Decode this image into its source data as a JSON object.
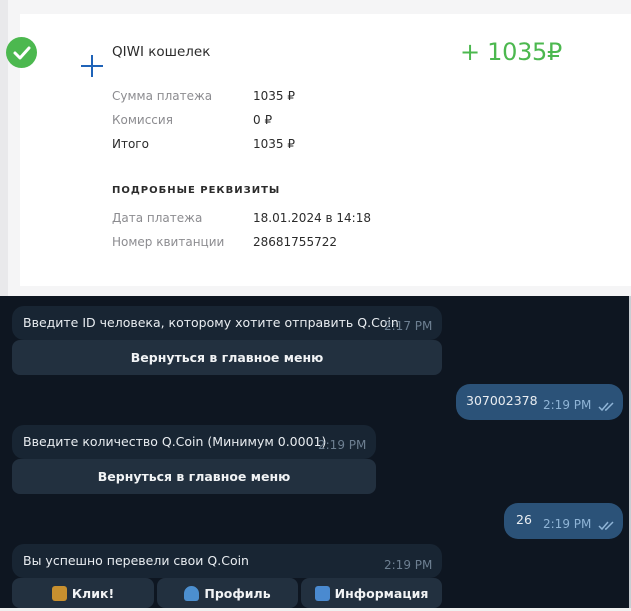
{
  "receipt": {
    "merchant": "QIWI кошелек",
    "amount": "+ 1035₽",
    "rows": [
      {
        "label": "Сумма платежа",
        "value": "1035 ₽"
      },
      {
        "label": "Комиссия",
        "value": "0 ₽"
      },
      {
        "label": "Итого",
        "value": "1035 ₽"
      }
    ],
    "details_heading": "ПОДРОБНЫЕ РЕКВИЗИТЫ",
    "details": [
      {
        "label": "Дата платежа",
        "value": "18.01.2024 в 14:18"
      },
      {
        "label": "Номер квитанции",
        "value": "28681755722"
      }
    ],
    "icons": [
      "check-icon",
      "plus-icon"
    ],
    "colors": {
      "accent": "#4cb84f",
      "muted": "#8c8c90"
    }
  },
  "chat": {
    "messages": [
      {
        "text": "Введите ID человека, которому хотите отправить Q.Coin",
        "time": "2:17 PM",
        "button": "Вернуться в главное меню"
      },
      {
        "text": "307002378",
        "time": "2:19 PM"
      },
      {
        "text": "Введите количество Q.Coin (Минимум 0.0001)",
        "time": "2:19 PM",
        "button": "Вернуться в главное меню"
      },
      {
        "text": "26",
        "time": "2:19 PM"
      },
      {
        "text": "Вы успешно перевели свои Q.Coin",
        "time": "2:19 PM"
      }
    ],
    "keyboard": [
      {
        "label": "Клик!",
        "icon": "money-bag-icon"
      },
      {
        "label": "Профиль",
        "icon": "user-icon"
      },
      {
        "label": "Информация",
        "icon": "info-icon"
      }
    ],
    "colors": {
      "background": "#0e1621",
      "incoming": "#182533",
      "outgoing": "#2b5278",
      "button": "#22303f"
    }
  }
}
